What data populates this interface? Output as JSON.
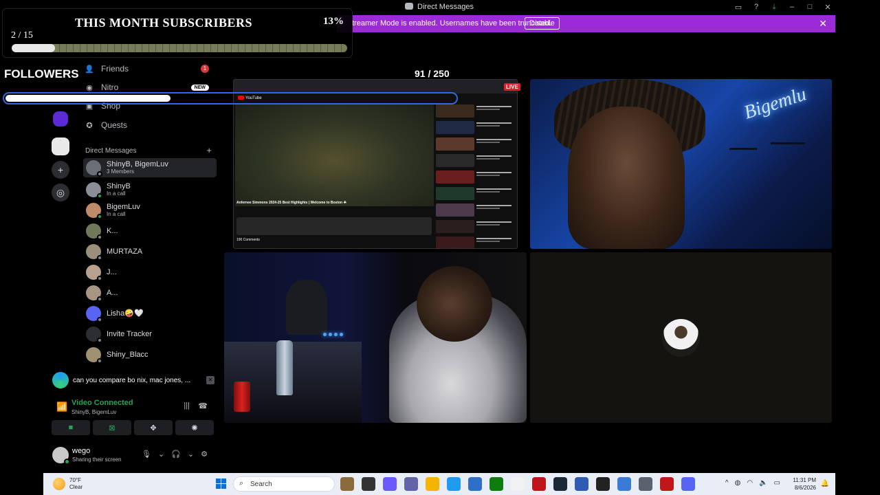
{
  "window": {
    "title": "Direct Messages"
  },
  "banner": {
    "message": "treamer Mode is enabled. Usernames have been truncated.",
    "button": "Disable"
  },
  "subscribers_overlay": {
    "title": "THIS MONTH SUBSCRIBERS",
    "percent_label": "13%",
    "count_label": "2 / 15",
    "progress_fraction": 0.13
  },
  "followers_overlay": {
    "title": "FOLLOWERS",
    "count_label": "91 / 250",
    "progress_fraction": 0.364
  },
  "nav": {
    "friends": "Friends",
    "friends_badge": "1",
    "nitro": "Nitro",
    "nitro_badge": "NEW",
    "shop": "Shop",
    "quests": "Quests"
  },
  "dm_header": "Direct Messages",
  "dms": [
    {
      "name": "ShinyB, BigemLuv",
      "sub": "3 Members",
      "active": true
    },
    {
      "name": "ShinyB",
      "sub": "In a call"
    },
    {
      "name": "BigemLuv",
      "sub": "In a call"
    },
    {
      "name": "K...",
      "sub": ""
    },
    {
      "name": "MURTAZA",
      "sub": ""
    },
    {
      "name": "J...",
      "sub": ""
    },
    {
      "name": "A...",
      "sub": ""
    },
    {
      "name": "Lisha🤪🤍",
      "sub": ""
    },
    {
      "name": "Invite Tracker",
      "sub": ""
    },
    {
      "name": "Shiny_Blacc",
      "sub": ""
    }
  ],
  "notification": {
    "text": "can you compare bo nix, mac jones, ..."
  },
  "voice": {
    "status": "Video Connected",
    "channel": "ShinyB, BigemLuv"
  },
  "user_panel": {
    "name": "wego",
    "status": "Sharing their screen"
  },
  "stream": {
    "live_label": "LIVE",
    "video_title": "Anfernee Simmons 2024-25 Best Highlights | Welcome to Boston ☘",
    "comments_label": "190 Comments"
  },
  "neon_sign": "Bigemlu",
  "taskbar": {
    "weather_temp": "70°F",
    "weather_desc": "Clear",
    "search_placeholder": "Search",
    "time": "11:31 PM",
    "date": "8/6/2026"
  },
  "colors": {
    "banner": "#9b2bd7",
    "online": "#23a55a",
    "live": "#e8192c",
    "follower_bar": "#2f6be0"
  }
}
